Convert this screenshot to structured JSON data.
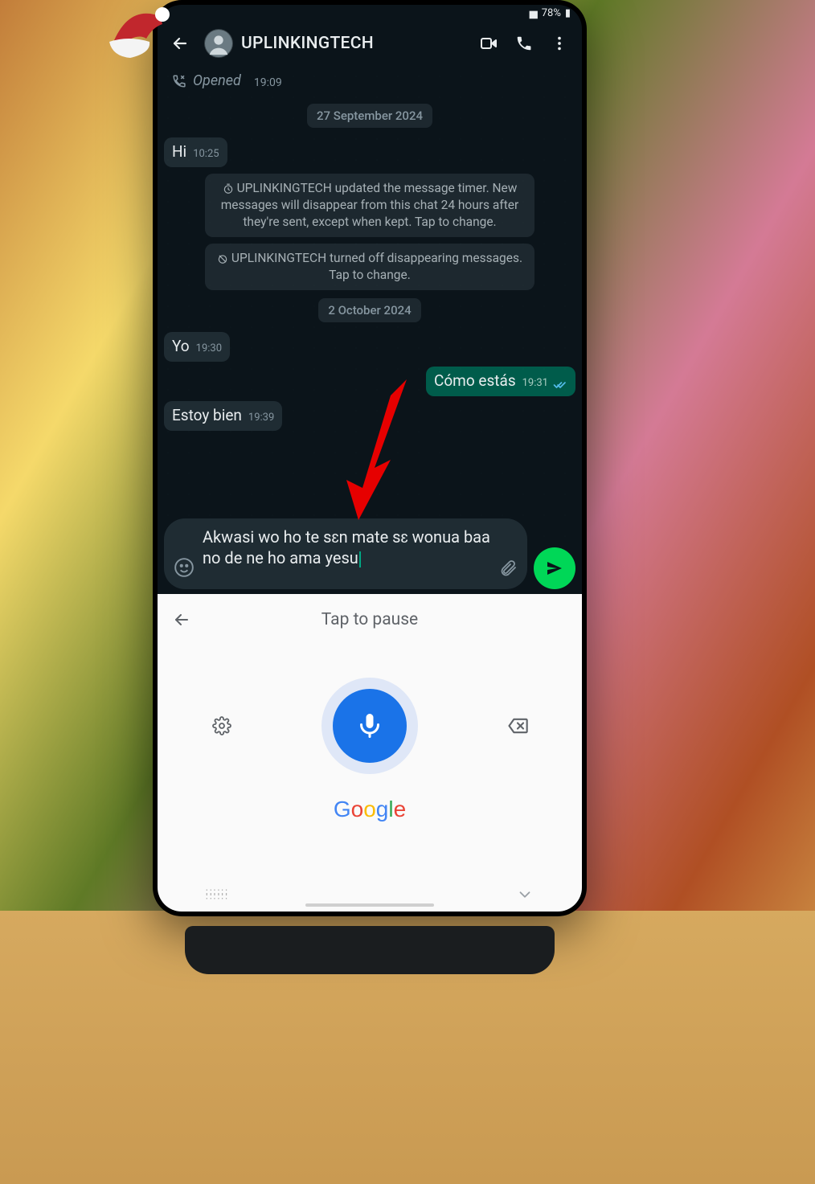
{
  "status_bar": {
    "battery": "78%"
  },
  "header": {
    "contact_name": "UPLINKINGTECH"
  },
  "opened_row": {
    "label": "Opened",
    "time": "19:09"
  },
  "dates": {
    "d1": "27 September 2024",
    "d2": "2 October 2024"
  },
  "system_messages": {
    "s1": "UPLINKINGTECH updated the message timer. New messages will disappear from this chat 24 hours after they're sent, except when kept. Tap to change.",
    "s2": "UPLINKINGTECH turned off disappearing messages. Tap to change."
  },
  "messages": {
    "m1": {
      "text": "Hi",
      "time": "10:25"
    },
    "m2": {
      "text": "Yo",
      "time": "19:30"
    },
    "m3": {
      "text": "Cómo estás",
      "time": "19:31"
    },
    "m4": {
      "text": "Estoy bien",
      "time": "19:39"
    }
  },
  "input": {
    "text": "Akwasi wo ho te sɛn mate sɛ wonua baa no de ne ho ama yesu"
  },
  "voice_panel": {
    "title": "Tap to pause",
    "provider": "Google"
  }
}
